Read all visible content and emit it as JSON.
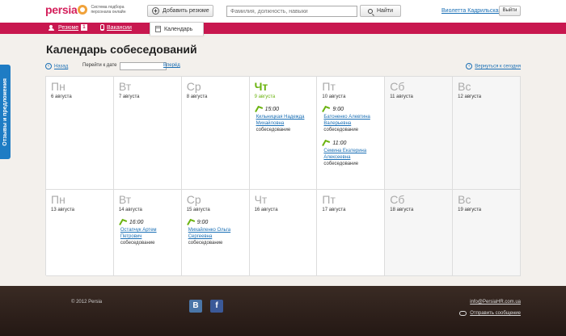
{
  "header": {
    "logo_text": "persia",
    "logo_tagline": "Система подбора персонала онлайн",
    "add_resume": "Добавить резюме",
    "search_placeholder": "Фамилия, должность, навыки",
    "find_button": "Найти",
    "user_name": "Виолетта Кадрильская",
    "exit_button": "Выйти"
  },
  "nav": {
    "resumes": "Резюме",
    "resumes_count": "1",
    "vacancies": "Вакансии",
    "calendar": "Календарь"
  },
  "feedback_tab": "Отзывы и предложения",
  "page_title": "Календарь собеседований",
  "subnav": {
    "back": "Назад",
    "goto_date": "Перейти к дате",
    "forward": "Вперёд",
    "today": "Вернуться к сегодня"
  },
  "weeks": [
    [
      {
        "day": "Пн",
        "date": "6 августа"
      },
      {
        "day": "Вт",
        "date": "7 августа"
      },
      {
        "day": "Ср",
        "date": "8 августа"
      },
      {
        "day": "Чт",
        "date": "9 августа",
        "today": true,
        "events": [
          {
            "time": "15:00",
            "name": "Кильницкая Надежда Михайловна",
            "type": "собеседование"
          }
        ]
      },
      {
        "day": "Пт",
        "date": "10 августа",
        "events": [
          {
            "time": "9:00",
            "name": "Батоненко Алевтина Валерьевна",
            "type": "собеседование"
          },
          {
            "time": "11:00",
            "name": "Семина Екатерина Алексеевна",
            "type": "собеседование"
          }
        ]
      },
      {
        "day": "Сб",
        "date": "11 августа",
        "weekend": true
      },
      {
        "day": "Вс",
        "date": "12 августа",
        "weekend": true
      }
    ],
    [
      {
        "day": "Пн",
        "date": "13 августа"
      },
      {
        "day": "Вт",
        "date": "14 августа",
        "events": [
          {
            "time": "16:00",
            "name": "Остапчук Артем Петрович",
            "type": "собеседование"
          }
        ]
      },
      {
        "day": "Ср",
        "date": "15 августа",
        "events": [
          {
            "time": "9:00",
            "name": "Михайленко Ольга Сергеевна",
            "type": "собеседование"
          }
        ]
      },
      {
        "day": "Чт",
        "date": "16 августа"
      },
      {
        "day": "Пт",
        "date": "17 августа"
      },
      {
        "day": "Сб",
        "date": "18 августа",
        "weekend": true
      },
      {
        "day": "Вс",
        "date": "19 августа",
        "weekend": true
      }
    ]
  ],
  "footer": {
    "copyright": "© 2012 Persia",
    "vk": "В",
    "fb": "f",
    "email": "info@PersiaHR.com.ua",
    "send_message": "Отправить сообщение"
  },
  "colors": {
    "brand": "#c8174f",
    "today": "#6bb30f",
    "link": "#1a6fb5",
    "feedback": "#1e7cc4"
  }
}
